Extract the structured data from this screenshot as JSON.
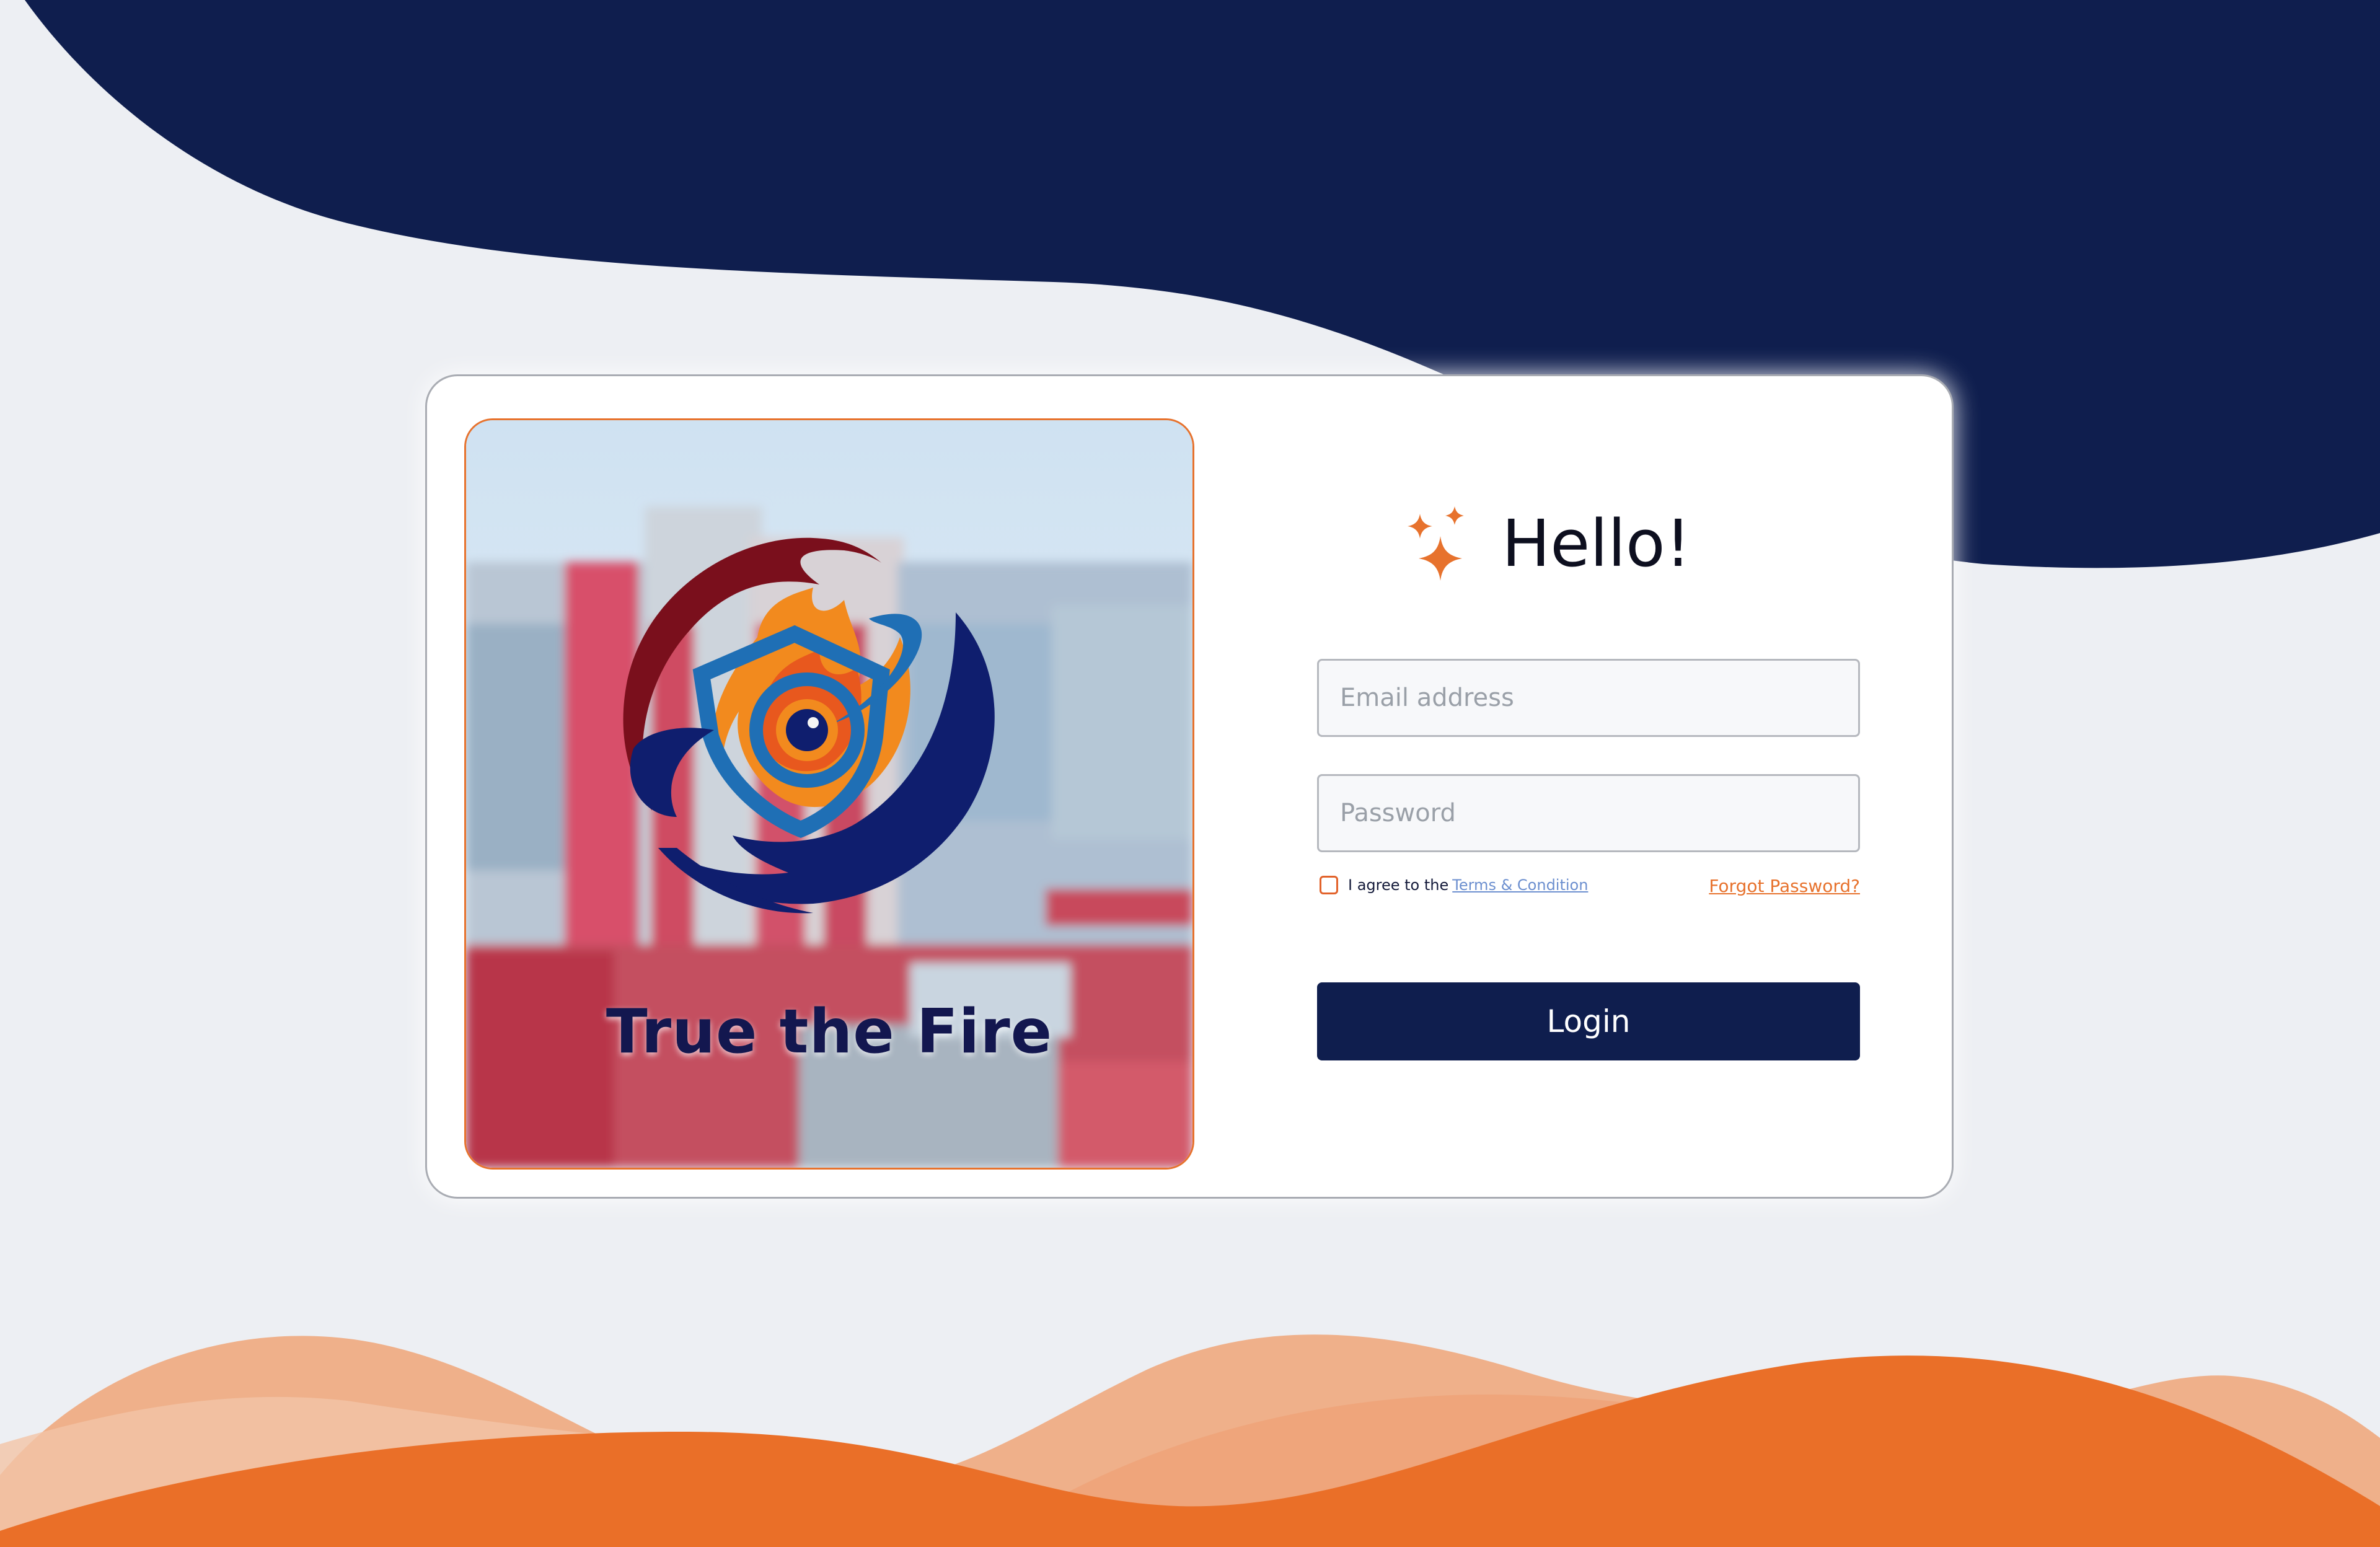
{
  "brand": {
    "name": "True the Fire"
  },
  "login": {
    "greeting": "Hello!",
    "email_placeholder": "Email address",
    "password_placeholder": "Password",
    "agree_text": "I agree to the",
    "terms_link": "Terms & Condition",
    "forgot_password": "Forgot Password?",
    "login_label": "Login"
  },
  "icons": {
    "greeting": "sparkle-icon",
    "logo": "fire-shield-eye-logo"
  },
  "colors": {
    "navy": "#0f1e4e",
    "orange": "#e7722d",
    "background": "#edeff3"
  }
}
